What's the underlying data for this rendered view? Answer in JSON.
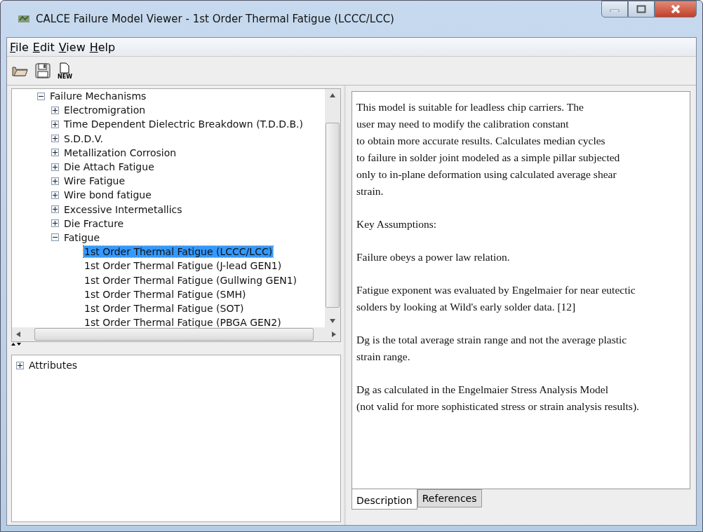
{
  "window": {
    "title": "CALCE Failure Model Viewer - 1st Order Thermal Fatigue (LCCC/LCC)"
  },
  "menu": [
    "File",
    "Edit",
    "View",
    "Help"
  ],
  "toolbar": [
    {
      "kind": "open"
    },
    {
      "kind": "save"
    },
    {
      "kind": "new",
      "label": "NEW"
    }
  ],
  "tree": [
    {
      "label": "Failure Mechanisms",
      "expanded": true,
      "selected": false,
      "children": [
        {
          "label": "Electromigration",
          "expanded": false,
          "selected": false
        },
        {
          "label": "Time Dependent Dielectric Breakdown (T.D.D.B.)",
          "expanded": false,
          "selected": false
        },
        {
          "label": "S.D.D.V.",
          "expanded": false,
          "selected": false
        },
        {
          "label": "Metallization Corrosion",
          "expanded": false,
          "selected": false
        },
        {
          "label": "Die Attach Fatigue",
          "expanded": false,
          "selected": false
        },
        {
          "label": "Wire Fatigue",
          "expanded": false,
          "selected": false
        },
        {
          "label": "Wire bond fatigue",
          "expanded": false,
          "selected": false
        },
        {
          "label": "Excessive Intermetallics",
          "expanded": false,
          "selected": false
        },
        {
          "label": "Die Fracture",
          "expanded": false,
          "selected": false
        },
        {
          "label": "Fatigue",
          "expanded": true,
          "selected": false,
          "children": [
            {
              "label": "1st Order Thermal Fatigue (LCCC/LCC)",
              "selected": true
            },
            {
              "label": "1st Order Thermal Fatigue (J-lead GEN1)",
              "selected": false
            },
            {
              "label": "1st Order Thermal Fatigue (Gullwing GEN1)",
              "selected": false
            },
            {
              "label": "1st Order Thermal Fatigue (SMH)",
              "selected": false
            },
            {
              "label": "1st Order Thermal Fatigue (SOT)",
              "selected": false
            },
            {
              "label": "1st Order Thermal Fatigue (PBGA GEN2)",
              "selected": false
            }
          ]
        }
      ]
    }
  ],
  "attributes": [
    {
      "label": "Attributes",
      "expanded": false
    }
  ],
  "description": [
    "This model is suitable for leadless chip carriers.  The\nuser may need to modify the calibration constant\nto obtain more accurate results.  Calculates median cycles\nto failure in solder joint modeled as a simple pillar subjected\nonly to in-plane deformation using calculated average shear\nstrain.",
    "Key Assumptions:",
    "Failure obeys a power law relation.",
    "Fatigue exponent was evaluated by Engelmaier for near eutectic\nsolders by looking at Wild's early solder data. [12]",
    "Dg is the total average strain range and not the average plastic\nstrain range.",
    "Dg as calculated in the Engelmaier Stress Analysis Model\n(not valid for more sophisticated stress or strain analysis results)."
  ],
  "tabs": [
    {
      "label": "Description",
      "selected": true
    },
    {
      "label": "References",
      "selected": false
    }
  ]
}
